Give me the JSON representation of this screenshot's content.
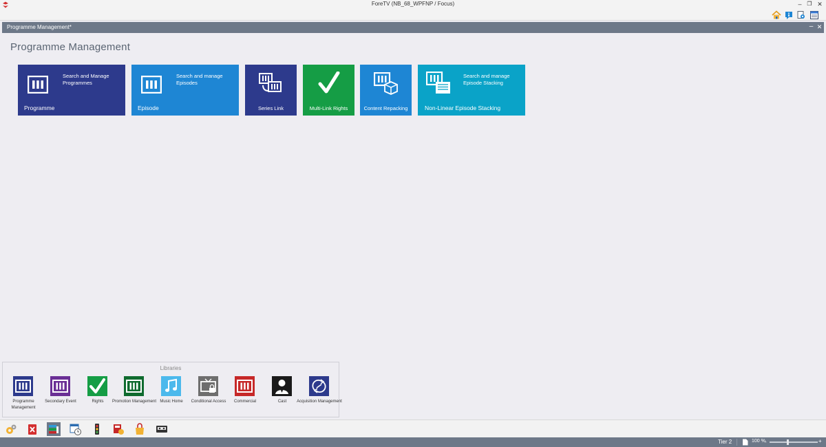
{
  "window": {
    "title": "ForeTV (NB_68_WPFNP / Focus)",
    "minimize": "–",
    "restore": "❐",
    "close": "✕"
  },
  "toolbar": {
    "icons": [
      "home-icon",
      "info-icon",
      "view-icon",
      "layout-icon"
    ]
  },
  "document": {
    "tab_title": "Programme Management*",
    "minimize": "–",
    "close": "✕"
  },
  "page": {
    "title": "Programme Management"
  },
  "tiles": [
    {
      "label": "Programme",
      "description": "Search and Manage Programmes",
      "color": "#2d3a8c",
      "icon": "film-strip-icon"
    },
    {
      "label": "Episode",
      "description": "Search and manage Episodes",
      "color": "#1e86d4",
      "icon": "film-strip-icon"
    },
    {
      "label": "Series Link",
      "description": "",
      "color": "#2d3a8c",
      "icon": "series-link-icon"
    },
    {
      "label": "Multi-Link Rights",
      "description": "",
      "color": "#159d45",
      "icon": "checkmark-icon"
    },
    {
      "label": "Content Repacking",
      "description": "",
      "color": "#1e86d4",
      "icon": "repack-box-icon"
    },
    {
      "label": "Non-Linear Episode Stacking",
      "description": "Search and manage Episode Stacking",
      "color": "#0aa3c8",
      "icon": "episode-stacking-icon"
    }
  ],
  "libraries": {
    "title": "Libraries",
    "items": [
      {
        "label": "Programme Management",
        "color": "#2d3a8c",
        "icon": "film-strip-icon"
      },
      {
        "label": "Secondary Event",
        "color": "#6a2f95",
        "icon": "film-strip-icon"
      },
      {
        "label": "Rights",
        "color": "#159d45",
        "icon": "checkmark-icon"
      },
      {
        "label": "Promotion Management",
        "color": "#0f6b2f",
        "icon": "film-strip-icon"
      },
      {
        "label": "Music Home",
        "color": "#4cb9ec",
        "icon": "music-note-icon"
      },
      {
        "label": "Conditional Access",
        "color": "#6e6e6e",
        "icon": "tv-lock-icon"
      },
      {
        "label": "Commercial",
        "color": "#c62828",
        "icon": "film-strip-icon"
      },
      {
        "label": "Cast",
        "color": "#1a1a1a",
        "icon": "person-icon"
      },
      {
        "label": "Acquisition Management",
        "color": "#2d3a8c",
        "icon": "acquisition-icon"
      }
    ]
  },
  "taskbar": {
    "items": [
      "gears-icon",
      "delete-icon",
      "library-stack-icon",
      "schedule-icon",
      "traffic-light-icon",
      "media-icon",
      "bag-icon",
      "cassette-icon"
    ],
    "active_index": 2
  },
  "status": {
    "tier": "Tier 2",
    "zoom": "100 %"
  }
}
